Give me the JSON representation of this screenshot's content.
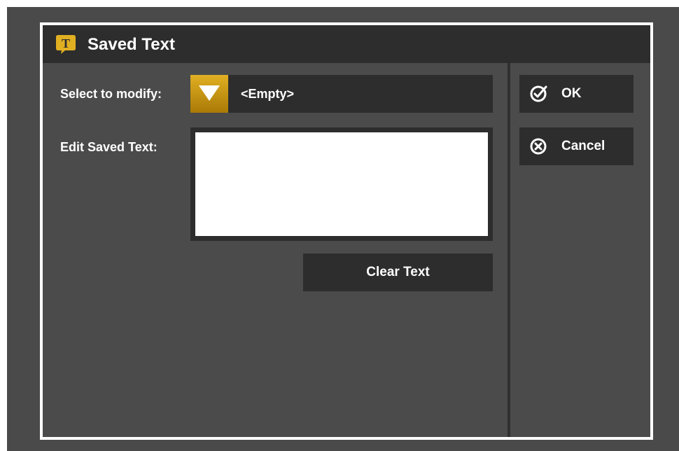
{
  "window": {
    "title": "Saved Text",
    "app_icon": "speech-bubble-T-icon",
    "app_icon_letter": "T",
    "accent_color": "#e1b022"
  },
  "form": {
    "select_label": "Select to modify:",
    "select_value": "<Empty>",
    "edit_label": "Edit Saved Text:",
    "edit_value": "",
    "clear_button": "Clear Text"
  },
  "actions": {
    "ok_label": "OK",
    "ok_icon": "check-circle-icon",
    "cancel_label": "Cancel",
    "cancel_icon": "x-circle-icon"
  }
}
